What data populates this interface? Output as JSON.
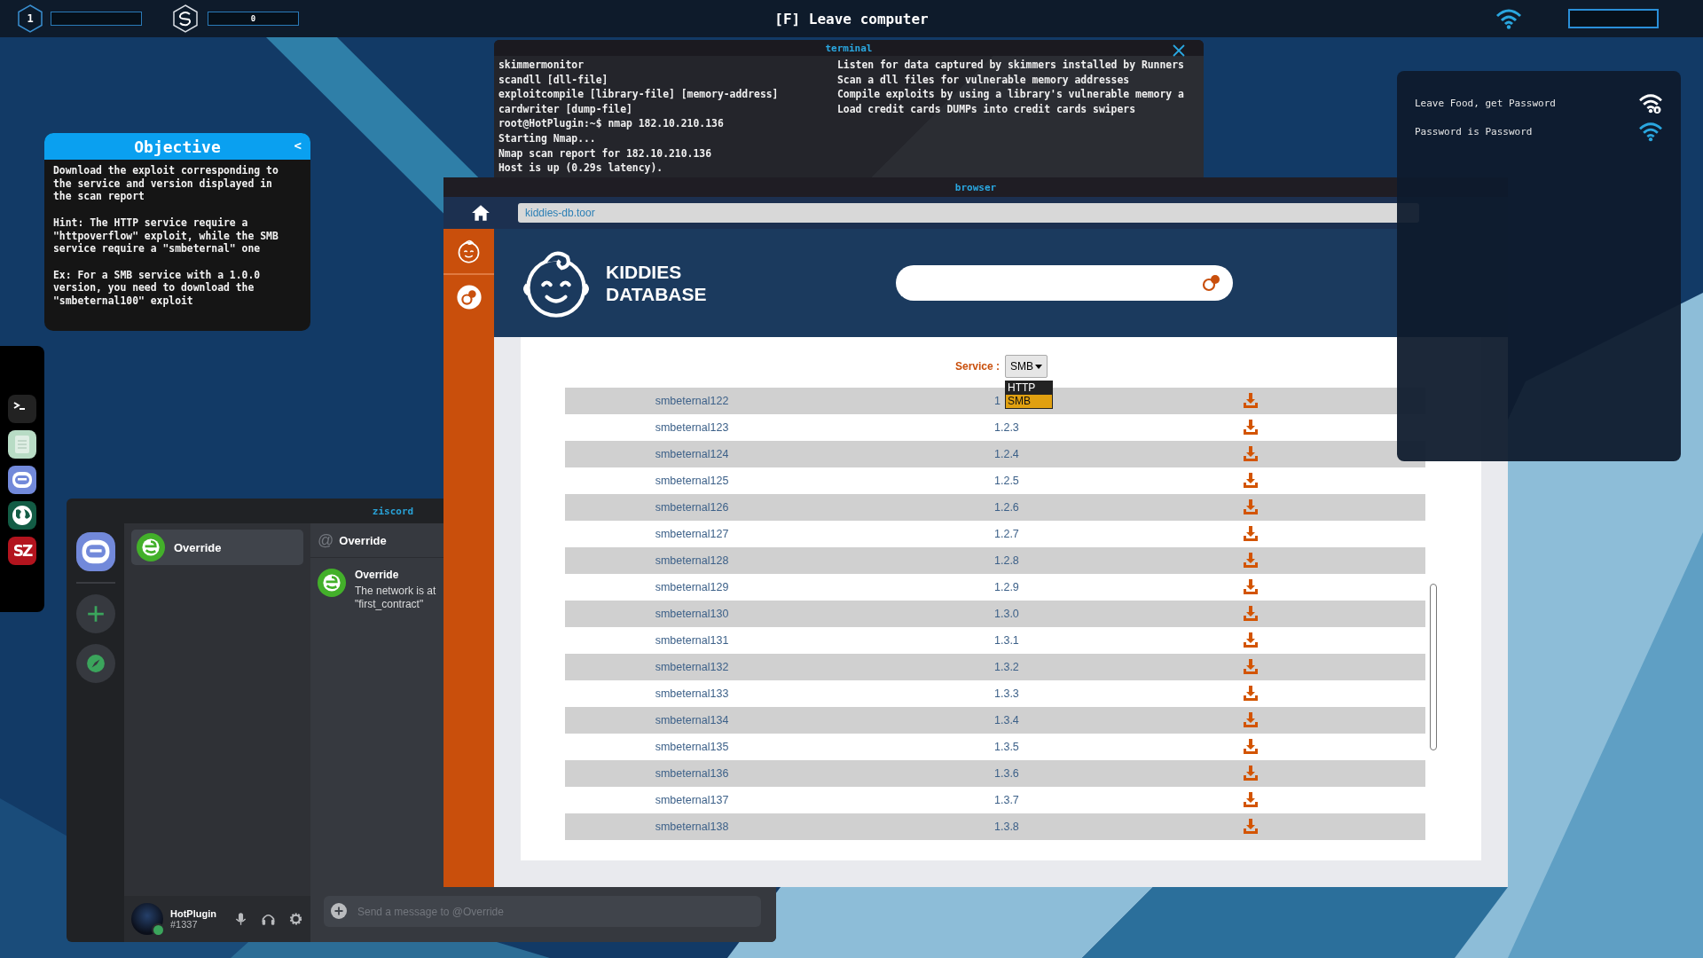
{
  "top_bar": {
    "level": "1",
    "credits": "0",
    "title": "[F] Leave computer"
  },
  "terminal": {
    "title": "terminal",
    "commands": [
      {
        "command": "skimmermonitor",
        "description": "Listen for data captured by skimmers installed by Runners"
      },
      {
        "command": "scandll [dll-file]",
        "description": "Scan a dll files for vulnerable memory addresses"
      },
      {
        "command": "exploitcompile [library-file] [memory-address]",
        "description": "Compile exploits by using a library's vulnerable memory a"
      },
      {
        "command": "cardwriter [dump-file]",
        "description": "Load credit cards DUMPs into credit cards swipers"
      }
    ],
    "output": [
      "root@HotPlugin:~$ nmap 182.10.210.136",
      "Starting Nmap...",
      "Nmap scan report for 182.10.210.136",
      "Host is up (0.29s latency)."
    ]
  },
  "objective": {
    "title": "Objective",
    "collapse": "<",
    "paragraphs": [
      "Download the exploit corresponding to the service and version displayed in the scan report",
      "Hint: The HTTP service require a \"httpoverflow\" exploit, while the SMB service require a \"smbeternal\" one",
      "Ex: For a SMB service with a 1.0.0 version, you need to download the \"smbeternal100\" exploit"
    ]
  },
  "wifi_panel": {
    "networks": [
      {
        "name": "Leave Food, get Password",
        "locked": true,
        "connected": false
      },
      {
        "name": "Password is Password",
        "locked": false,
        "connected": true
      }
    ]
  },
  "dock": {
    "items": [
      {
        "kind": "terminal"
      },
      {
        "kind": "notes"
      },
      {
        "kind": "chat"
      },
      {
        "kind": "globe"
      },
      {
        "kind": "logo",
        "label": "SZ"
      }
    ]
  },
  "ziscord": {
    "title": "ziscord",
    "conversations": [
      {
        "name": "Override",
        "selected": true
      }
    ],
    "chat": {
      "prefix": "@",
      "recipient": "Override",
      "messages": [
        {
          "author": "Override",
          "lines": [
            "The network is at",
            "\"first_contract\""
          ]
        }
      ],
      "placeholder": "Send a message to @Override"
    },
    "user": {
      "name": "HotPlugin",
      "tag": "#1337",
      "online": true
    }
  },
  "browser": {
    "title": "browser",
    "url": "kiddies-db.toor",
    "site_name": [
      "KIDDIES",
      "DATABASE"
    ],
    "service_label": "Service :",
    "service_value": "SMB",
    "service_options": [
      {
        "label": "HTTP",
        "selected": false
      },
      {
        "label": "SMB",
        "selected": true
      }
    ],
    "rows": [
      {
        "name": "smbeternal122",
        "version": "1"
      },
      {
        "name": "smbeternal123",
        "version": "1.2.3"
      },
      {
        "name": "smbeternal124",
        "version": "1.2.4"
      },
      {
        "name": "smbeternal125",
        "version": "1.2.5"
      },
      {
        "name": "smbeternal126",
        "version": "1.2.6"
      },
      {
        "name": "smbeternal127",
        "version": "1.2.7"
      },
      {
        "name": "smbeternal128",
        "version": "1.2.8"
      },
      {
        "name": "smbeternal129",
        "version": "1.2.9"
      },
      {
        "name": "smbeternal130",
        "version": "1.3.0"
      },
      {
        "name": "smbeternal131",
        "version": "1.3.1"
      },
      {
        "name": "smbeternal132",
        "version": "1.3.2"
      },
      {
        "name": "smbeternal133",
        "version": "1.3.3"
      },
      {
        "name": "smbeternal134",
        "version": "1.3.4"
      },
      {
        "name": "smbeternal135",
        "version": "1.3.5"
      },
      {
        "name": "smbeternal136",
        "version": "1.3.6"
      },
      {
        "name": "smbeternal137",
        "version": "1.3.7"
      },
      {
        "name": "smbeternal138",
        "version": "1.3.8"
      }
    ]
  }
}
